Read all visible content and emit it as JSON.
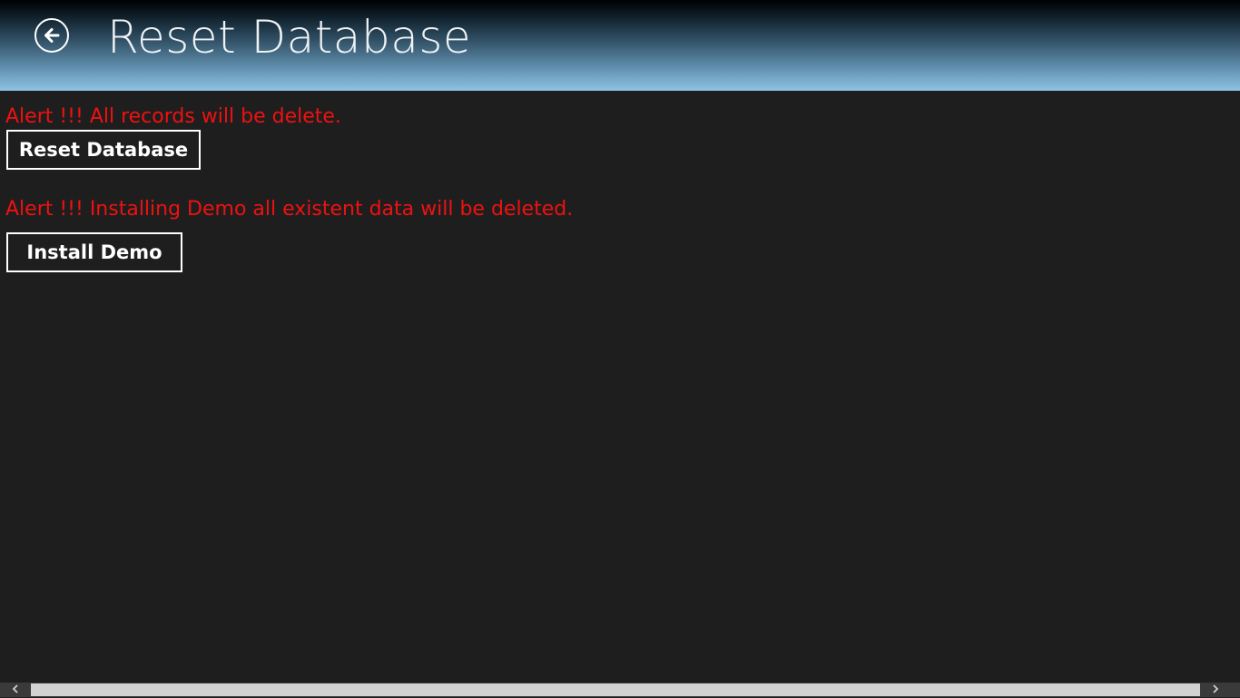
{
  "header": {
    "title": "Reset Database",
    "back_icon": "back-arrow-circle-icon"
  },
  "sections": {
    "reset": {
      "alert": "Alert !!! All records will be delete.",
      "button_label": "Reset Database"
    },
    "demo": {
      "alert": "Alert !!! Installing Demo all existent data will be deleted.",
      "button_label": "Install Demo"
    }
  },
  "scrollbar": {
    "left_icon": "chevron-left-icon",
    "right_icon": "chevron-right-icon"
  },
  "colors": {
    "background": "#1e1e1e",
    "alert_text": "#ee1111",
    "header_gradient_top": "#000000",
    "header_gradient_bottom": "#8ec4e4"
  }
}
